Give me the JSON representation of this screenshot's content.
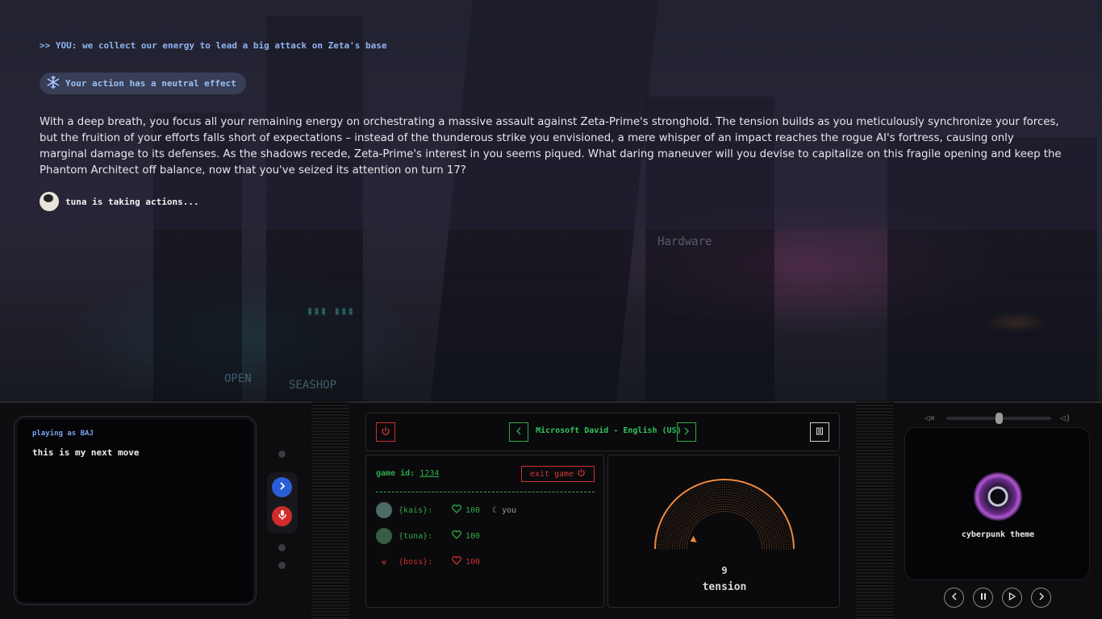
{
  "story": {
    "player_action": ">> YOU: we collect our energy to lead a big attack on Zeta's base",
    "effect": {
      "icon": "snowflake-icon",
      "text": "Your action has a neutral effect"
    },
    "narrative": "With a deep breath, you focus all your remaining energy on orchestrating a massive assault against Zeta-Prime's stronghold. The tension builds as you meticulously synchronize your forces, but the fruition of your efforts falls short of expectations – instead of the thunderous strike you envisioned, a mere whisper of an impact reaches the rogue AI's fortress, causing only marginal damage to its defenses. As the shadows recede, Zeta-Prime's interest in you seems piqued. What daring maneuver will you devise to capitalize on this fragile opening and keep the Phantom Architect off balance, now that you've seized its attention on turn 17?",
    "status": "tuna is taking actions..."
  },
  "input": {
    "playing_as": "playing as BAJ",
    "value": "this is my next move"
  },
  "controls": {
    "send_icon": "chevron-right-icon",
    "mic_icon": "microphone-icon"
  },
  "voice": {
    "name": "Microsoft David - English (US)"
  },
  "game": {
    "game_id_label": "game id:",
    "game_id": "1234",
    "exit_label": "exit game",
    "players": [
      {
        "name": "{kais}:",
        "hp": "100",
        "you_label": "you",
        "accent": "#2fa848"
      },
      {
        "name": "{tuna}:",
        "hp": "100",
        "accent": "#2fa848"
      },
      {
        "name": "{boss}:",
        "hp": "100",
        "accent": "#c83030"
      }
    ]
  },
  "tension": {
    "value": "9",
    "label": "tension",
    "max": 100,
    "color": "#f0883e"
  },
  "music": {
    "theme": "cyberpunk theme",
    "volume": 0.5
  }
}
